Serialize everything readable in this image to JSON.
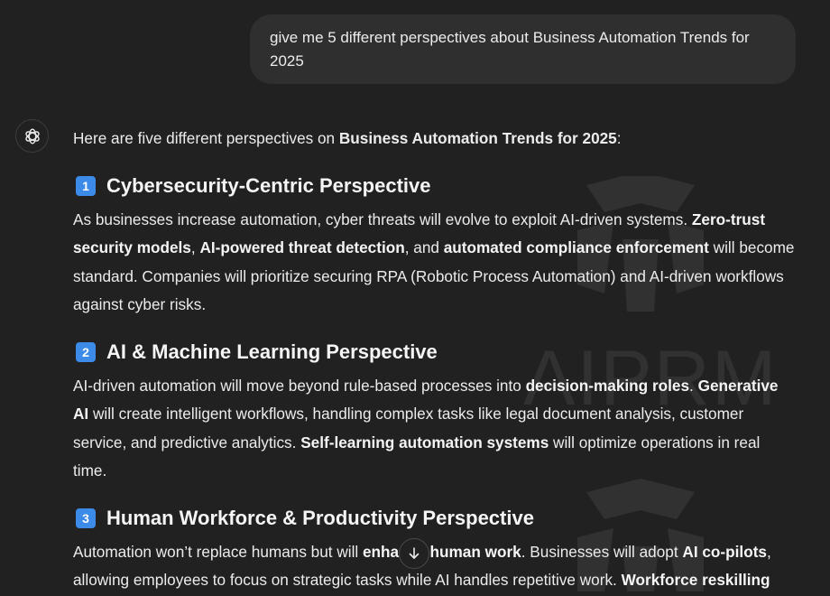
{
  "user_message": {
    "text": "give me 5 different perspectives about Business Automation Trends for 2025"
  },
  "assistant": {
    "avatar_icon": "openai-logo-icon",
    "intro_prefix": "Here are five different perspectives on ",
    "intro_bold": "Business Automation Trends for 2025",
    "intro_suffix": ":",
    "badge_color": "#3d8be8",
    "sections": [
      {
        "number": "1",
        "title": "Cybersecurity-Centric Perspective",
        "p1": "As businesses increase automation, cyber threats will evolve to exploit AI-driven systems. ",
        "b1": "Zero-trust security models",
        "p2": ", ",
        "b2": "AI-powered threat detection",
        "p3": ", and ",
        "b3": "automated compliance enforcement",
        "p4": " will become standard. Companies will prioritize securing RPA (Robotic Process Automation) and AI-driven workflows against cyber risks."
      },
      {
        "number": "2",
        "title": "AI & Machine Learning Perspective",
        "p1": "AI-driven automation will move beyond rule-based processes into ",
        "b1": "decision-making roles",
        "p2": ". ",
        "b2": "Generative AI",
        "p3": " will create intelligent workflows, handling complex tasks like legal document analysis, customer service, and predictive analytics. ",
        "b3": "Self-learning automation systems",
        "p4": " will optimize operations in real time."
      },
      {
        "number": "3",
        "title": "Human Workforce & Productivity Perspective",
        "p1": "Automation won’t replace humans but will ",
        "b1": "enhance human work",
        "p2": ". Businesses will adopt ",
        "b2": "AI co-pilots",
        "p3": ", allowing employees to focus on strategic tasks while AI handles repetitive work. ",
        "b3": "Workforce reskilling",
        "p4": ""
      }
    ]
  },
  "watermark": {
    "text": "AIPRM"
  },
  "scroll_button": {
    "icon": "arrow-down-icon"
  }
}
